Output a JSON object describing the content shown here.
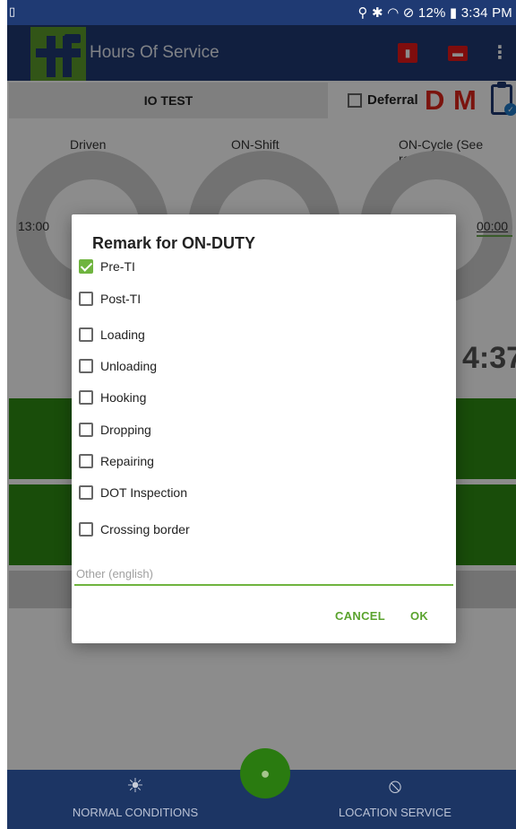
{
  "statusbar": {
    "left_icon": "▯",
    "right_text": "⚲ ✱ ◠ ⊘ 12% ▮ 3:34 PM"
  },
  "appbar": {
    "title": "Hours Of Service",
    "icons": [
      "phone-alert-icon",
      "truck-icon",
      "more-vert-icon"
    ]
  },
  "info": {
    "driver_name": "IO TEST",
    "deferral_label": "Deferral",
    "d_label": "D",
    "m_label": "M"
  },
  "gauges": {
    "labels": [
      "Driven",
      "ON-Shift",
      "ON-Cycle (See recap)"
    ],
    "left_time": "13:00",
    "right_time": "00:00",
    "counter": "4:37"
  },
  "dialog": {
    "title": "Remark for ON-DUTY",
    "options": [
      {
        "label": "Pre-TI",
        "checked": true
      },
      {
        "label": "Post-TI",
        "checked": false
      },
      {
        "label": "Loading",
        "checked": false
      },
      {
        "label": "Unloading",
        "checked": false
      },
      {
        "label": "Hooking",
        "checked": false
      },
      {
        "label": "Dropping",
        "checked": false
      },
      {
        "label": "Repairing",
        "checked": false
      },
      {
        "label": "DOT Inspection",
        "checked": false
      },
      {
        "label": "Crossing border",
        "checked": false
      }
    ],
    "other_placeholder": "Other (english)",
    "cancel_label": "CANCEL",
    "ok_label": "OK"
  },
  "bottomnav": {
    "normal_label": "NORMAL CONDITIONS",
    "location_label": "LOCATION SERVICE"
  },
  "colors": {
    "primary": "#1f3a73",
    "accent": "#6fb43f",
    "alert": "#e0251b"
  }
}
